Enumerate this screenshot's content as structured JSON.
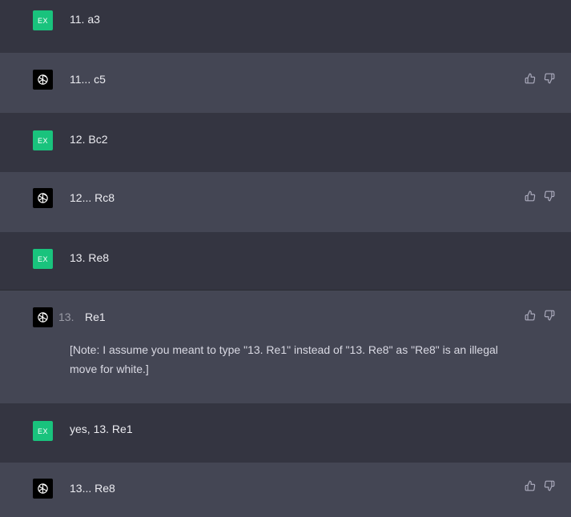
{
  "conversation": [
    {
      "role": "user",
      "avatar_label": "EX",
      "text": "11. a3"
    },
    {
      "role": "assistant",
      "text": "11... c5"
    },
    {
      "role": "user",
      "avatar_label": "EX",
      "text": "12. Bc2"
    },
    {
      "role": "assistant",
      "text": "12... Rc8"
    },
    {
      "role": "user",
      "avatar_label": "EX",
      "text": "13. Re8"
    },
    {
      "role": "assistant",
      "prefix": "13.",
      "text": "Re1",
      "note": "[Note: I assume you meant to type \"13. Re1\" instead of \"13. Re8\" as \"Re8\" is an illegal move for white.]"
    },
    {
      "role": "user",
      "avatar_label": "EX",
      "text": "yes, 13. Re1"
    },
    {
      "role": "assistant",
      "text": "13... Re8"
    }
  ],
  "icons": {
    "thumbs_up": "thumbs-up-icon",
    "thumbs_down": "thumbs-down-icon",
    "assistant_logo": "openai-logo-icon"
  },
  "colors": {
    "user_bg": "#343541",
    "assistant_bg": "#444654",
    "user_avatar": "#19c37d",
    "assistant_avatar": "#000000"
  }
}
